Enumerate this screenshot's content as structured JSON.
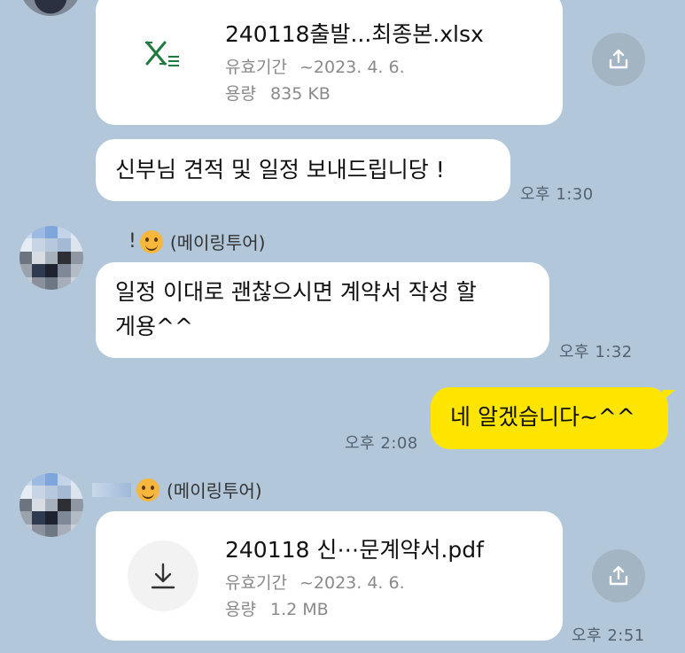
{
  "messages": {
    "file1": {
      "name": "240118출발...최종본.xlsx",
      "expiry_label": "유효기간",
      "expiry_value": "~2023. 4. 6.",
      "size_label": "용량",
      "size_value": "835 KB",
      "icon": "excel-file-icon"
    },
    "text1": {
      "text": "신부님 견적 및 일정 보내드립니당 !",
      "time": "오후 1:30"
    },
    "sender1": {
      "prefix": "!",
      "name": "(메이링투어)"
    },
    "text2": {
      "line1": "일정 이대로 괜찮으시면 계약서 작성 할",
      "line2": "게용^^",
      "time": "오후 1:32"
    },
    "mine1": {
      "text": "네 알겠습니다~^^",
      "time": "오후 2:08"
    },
    "sender2": {
      "name": "(메이링투어)"
    },
    "file2": {
      "name": "240118 신⋯문계약서.pdf",
      "expiry_label": "유효기간",
      "expiry_value": "~2023. 4. 6.",
      "size_label": "용량",
      "size_value": "1.2 MB",
      "time": "오후 2:51",
      "icon": "download-icon"
    }
  },
  "colors": {
    "background": "#b2c7d9",
    "my_bubble": "#fee500",
    "other_bubble": "#ffffff",
    "excel_green": "#1f7a3e"
  }
}
